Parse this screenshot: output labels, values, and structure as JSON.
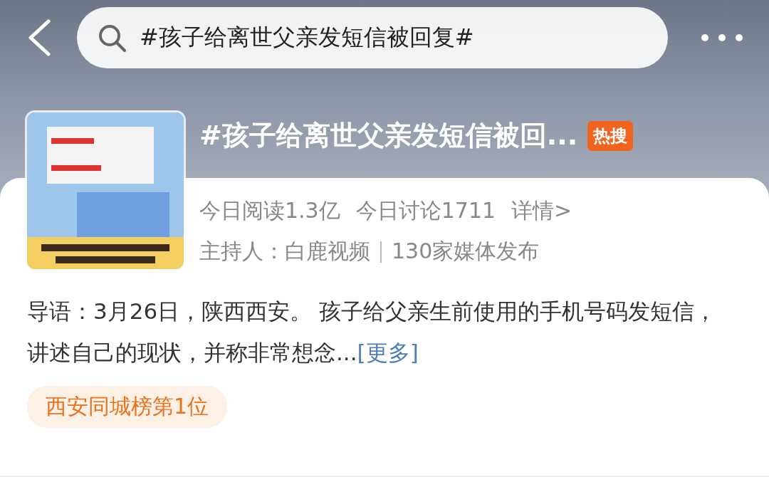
{
  "header": {
    "search": {
      "value": "#孩子给离世父亲发短信被回复#"
    }
  },
  "topic": {
    "title": "#孩子给离世父亲发短信被回...",
    "badge": "热搜",
    "stats": [
      "今日阅读1.3亿",
      "今日讨论1711"
    ],
    "details": "详情>",
    "host": "主持人：白鹿视频",
    "media": "130家媒体发布"
  },
  "intro": {
    "text": "导语：3月26日，陕西西安。 孩子给父亲生前使用的手机号码发短信，讲述自己的现状，并称非常想念...",
    "more": "[更多]"
  },
  "tags": [
    "西安同城榜第1位"
  ]
}
